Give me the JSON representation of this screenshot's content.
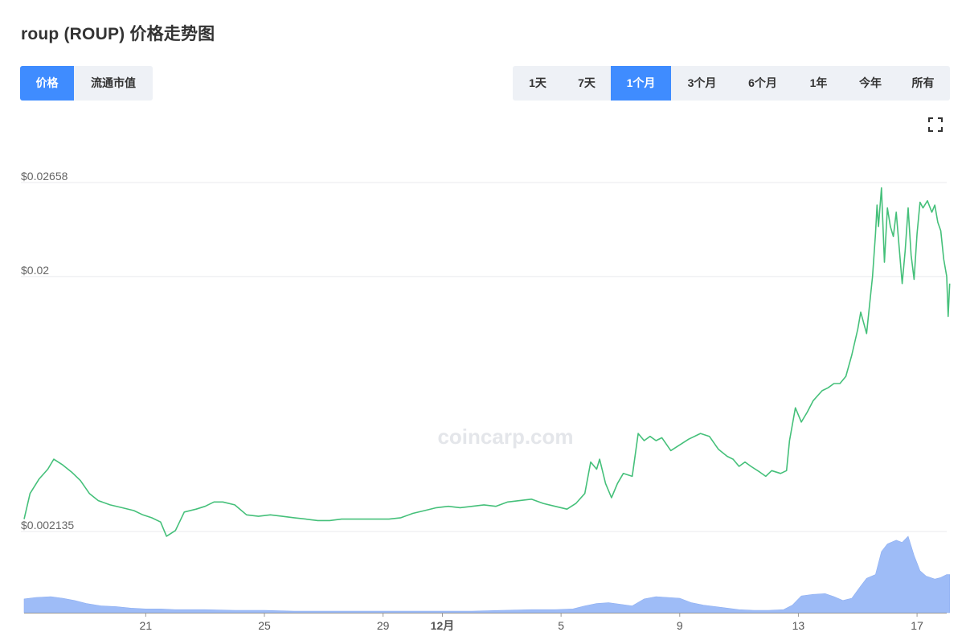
{
  "header": {
    "title": "roup (ROUP) 价格走势图"
  },
  "metric_tabs": [
    {
      "label": "价格",
      "active": true
    },
    {
      "label": "流通市值",
      "active": false
    }
  ],
  "range_tabs": [
    {
      "label": "1天",
      "active": false
    },
    {
      "label": "7天",
      "active": false
    },
    {
      "label": "1个月",
      "active": true
    },
    {
      "label": "3个月",
      "active": false
    },
    {
      "label": "6个月",
      "active": false
    },
    {
      "label": "1年",
      "active": false
    },
    {
      "label": "今年",
      "active": false
    },
    {
      "label": "所有",
      "active": false
    }
  ],
  "icons": {
    "fullscreen": "fullscreen-icon"
  },
  "watermark": "coincarp.com",
  "colors": {
    "accent": "#3f8cff",
    "price_line": "#45c07a",
    "volume_fill": "#9ebcf7",
    "tab_bg": "#eef1f6"
  },
  "chart_data": {
    "type": "line",
    "y_ticks": [
      {
        "value": 0.02658,
        "label": "$0.02658"
      },
      {
        "value": 0.02,
        "label": "$0.02"
      },
      {
        "value": 0.002135,
        "label": "$0.002135"
      }
    ],
    "x_ticks": [
      {
        "day": 21,
        "label": "21"
      },
      {
        "day": 25,
        "label": "25"
      },
      {
        "day": 29,
        "label": "29"
      },
      {
        "day": 31,
        "label": "12月"
      },
      {
        "day": 35,
        "label": "5"
      },
      {
        "day": 39,
        "label": "9"
      },
      {
        "day": 43,
        "label": "13"
      },
      {
        "day": 47,
        "label": "17"
      }
    ],
    "x_range": [
      16.9,
      48.0
    ],
    "y_range": [
      0.002135,
      0.02658
    ],
    "grid": true,
    "series": [
      {
        "values": [
          [
            16.9,
            0.003
          ],
          [
            17.1,
            0.0048
          ],
          [
            17.4,
            0.0058
          ],
          [
            17.7,
            0.0065
          ],
          [
            17.9,
            0.0072
          ],
          [
            18.2,
            0.0068
          ],
          [
            18.5,
            0.0063
          ],
          [
            18.8,
            0.0057
          ],
          [
            19.1,
            0.0048
          ],
          [
            19.4,
            0.0043
          ],
          [
            19.8,
            0.004
          ],
          [
            20.2,
            0.0038
          ],
          [
            20.6,
            0.0036
          ],
          [
            20.9,
            0.0033
          ],
          [
            21.2,
            0.0031
          ],
          [
            21.5,
            0.0028
          ],
          [
            21.7,
            0.0018
          ],
          [
            22.0,
            0.0022
          ],
          [
            22.3,
            0.0035
          ],
          [
            22.7,
            0.0037
          ],
          [
            23.0,
            0.0039
          ],
          [
            23.3,
            0.0042
          ],
          [
            23.6,
            0.0042
          ],
          [
            24.0,
            0.004
          ],
          [
            24.4,
            0.0033
          ],
          [
            24.8,
            0.0032
          ],
          [
            25.2,
            0.0033
          ],
          [
            25.6,
            0.0032
          ],
          [
            26.0,
            0.0031
          ],
          [
            26.4,
            0.003
          ],
          [
            26.8,
            0.0029
          ],
          [
            27.2,
            0.0029
          ],
          [
            27.6,
            0.003
          ],
          [
            28.0,
            0.003
          ],
          [
            28.4,
            0.003
          ],
          [
            28.8,
            0.003
          ],
          [
            29.2,
            0.003
          ],
          [
            29.6,
            0.0031
          ],
          [
            30.0,
            0.0034
          ],
          [
            30.4,
            0.0036
          ],
          [
            30.8,
            0.0038
          ],
          [
            31.2,
            0.0039
          ],
          [
            31.6,
            0.0038
          ],
          [
            32.0,
            0.0039
          ],
          [
            32.4,
            0.004
          ],
          [
            32.8,
            0.0039
          ],
          [
            33.2,
            0.0042
          ],
          [
            33.6,
            0.0043
          ],
          [
            34.0,
            0.0044
          ],
          [
            34.4,
            0.0041
          ],
          [
            34.8,
            0.0039
          ],
          [
            35.2,
            0.0037
          ],
          [
            35.5,
            0.0041
          ],
          [
            35.8,
            0.0048
          ],
          [
            36.0,
            0.007
          ],
          [
            36.2,
            0.0065
          ],
          [
            36.3,
            0.0072
          ],
          [
            36.5,
            0.0055
          ],
          [
            36.7,
            0.0045
          ],
          [
            36.9,
            0.0055
          ],
          [
            37.1,
            0.0062
          ],
          [
            37.4,
            0.006
          ],
          [
            37.6,
            0.009
          ],
          [
            37.8,
            0.0085
          ],
          [
            38.0,
            0.0088
          ],
          [
            38.2,
            0.0085
          ],
          [
            38.4,
            0.0087
          ],
          [
            38.7,
            0.0078
          ],
          [
            39.0,
            0.0082
          ],
          [
            39.3,
            0.0086
          ],
          [
            39.7,
            0.009
          ],
          [
            40.0,
            0.0088
          ],
          [
            40.3,
            0.0079
          ],
          [
            40.6,
            0.0074
          ],
          [
            40.8,
            0.0072
          ],
          [
            41.0,
            0.0067
          ],
          [
            41.2,
            0.007
          ],
          [
            41.4,
            0.0067
          ],
          [
            41.7,
            0.0063
          ],
          [
            41.9,
            0.006
          ],
          [
            42.1,
            0.0064
          ],
          [
            42.4,
            0.0062
          ],
          [
            42.6,
            0.0064
          ],
          [
            42.7,
            0.0085
          ],
          [
            42.9,
            0.0108
          ],
          [
            43.1,
            0.0098
          ],
          [
            43.3,
            0.0105
          ],
          [
            43.5,
            0.0113
          ],
          [
            43.8,
            0.012
          ],
          [
            44.0,
            0.0122
          ],
          [
            44.2,
            0.0125
          ],
          [
            44.4,
            0.0125
          ],
          [
            44.6,
            0.013
          ],
          [
            44.8,
            0.0145
          ],
          [
            45.0,
            0.0163
          ],
          [
            45.1,
            0.0175
          ],
          [
            45.3,
            0.016
          ],
          [
            45.5,
            0.02
          ],
          [
            45.6,
            0.023
          ],
          [
            45.65,
            0.025
          ],
          [
            45.7,
            0.0235
          ],
          [
            45.8,
            0.0262
          ],
          [
            45.9,
            0.021
          ],
          [
            46.0,
            0.0248
          ],
          [
            46.1,
            0.0235
          ],
          [
            46.2,
            0.0228
          ],
          [
            46.3,
            0.0245
          ],
          [
            46.4,
            0.022
          ],
          [
            46.5,
            0.0195
          ],
          [
            46.6,
            0.0218
          ],
          [
            46.7,
            0.0248
          ],
          [
            46.8,
            0.0215
          ],
          [
            46.9,
            0.0198
          ],
          [
            47.0,
            0.023
          ],
          [
            47.1,
            0.0252
          ],
          [
            47.2,
            0.0248
          ],
          [
            47.35,
            0.0253
          ],
          [
            47.5,
            0.0245
          ],
          [
            47.6,
            0.025
          ],
          [
            47.7,
            0.0238
          ],
          [
            47.8,
            0.0232
          ],
          [
            47.9,
            0.0212
          ],
          [
            48.0,
            0.02
          ],
          [
            48.05,
            0.0172
          ],
          [
            48.1,
            0.0195
          ]
        ]
      },
      {
        "volume_values": [
          [
            16.9,
            0.18
          ],
          [
            17.3,
            0.2
          ],
          [
            17.8,
            0.21
          ],
          [
            18.2,
            0.19
          ],
          [
            18.6,
            0.16
          ],
          [
            19.0,
            0.12
          ],
          [
            19.5,
            0.09
          ],
          [
            20.0,
            0.08
          ],
          [
            20.5,
            0.06
          ],
          [
            21.0,
            0.05
          ],
          [
            21.5,
            0.05
          ],
          [
            22.0,
            0.04
          ],
          [
            23.0,
            0.04
          ],
          [
            24.0,
            0.03
          ],
          [
            25.0,
            0.03
          ],
          [
            26.0,
            0.02
          ],
          [
            27.0,
            0.02
          ],
          [
            28.0,
            0.02
          ],
          [
            29.0,
            0.02
          ],
          [
            30.0,
            0.02
          ],
          [
            31.0,
            0.02
          ],
          [
            32.0,
            0.02
          ],
          [
            33.0,
            0.03
          ],
          [
            34.0,
            0.04
          ],
          [
            34.8,
            0.04
          ],
          [
            35.4,
            0.05
          ],
          [
            35.8,
            0.09
          ],
          [
            36.2,
            0.12
          ],
          [
            36.6,
            0.13
          ],
          [
            37.0,
            0.11
          ],
          [
            37.4,
            0.09
          ],
          [
            37.8,
            0.18
          ],
          [
            38.2,
            0.21
          ],
          [
            38.6,
            0.2
          ],
          [
            39.0,
            0.19
          ],
          [
            39.4,
            0.13
          ],
          [
            39.8,
            0.1
          ],
          [
            40.2,
            0.08
          ],
          [
            40.6,
            0.06
          ],
          [
            41.0,
            0.04
          ],
          [
            41.5,
            0.03
          ],
          [
            42.0,
            0.03
          ],
          [
            42.5,
            0.04
          ],
          [
            42.8,
            0.1
          ],
          [
            43.1,
            0.22
          ],
          [
            43.5,
            0.24
          ],
          [
            43.9,
            0.25
          ],
          [
            44.2,
            0.21
          ],
          [
            44.5,
            0.16
          ],
          [
            44.8,
            0.19
          ],
          [
            45.1,
            0.35
          ],
          [
            45.3,
            0.45
          ],
          [
            45.6,
            0.5
          ],
          [
            45.8,
            0.8
          ],
          [
            46.0,
            0.9
          ],
          [
            46.3,
            0.95
          ],
          [
            46.5,
            0.92
          ],
          [
            46.7,
            1.0
          ],
          [
            46.9,
            0.75
          ],
          [
            47.1,
            0.55
          ],
          [
            47.3,
            0.48
          ],
          [
            47.6,
            0.44
          ],
          [
            47.8,
            0.46
          ],
          [
            48.0,
            0.5
          ],
          [
            48.1,
            0.5
          ]
        ]
      }
    ]
  }
}
